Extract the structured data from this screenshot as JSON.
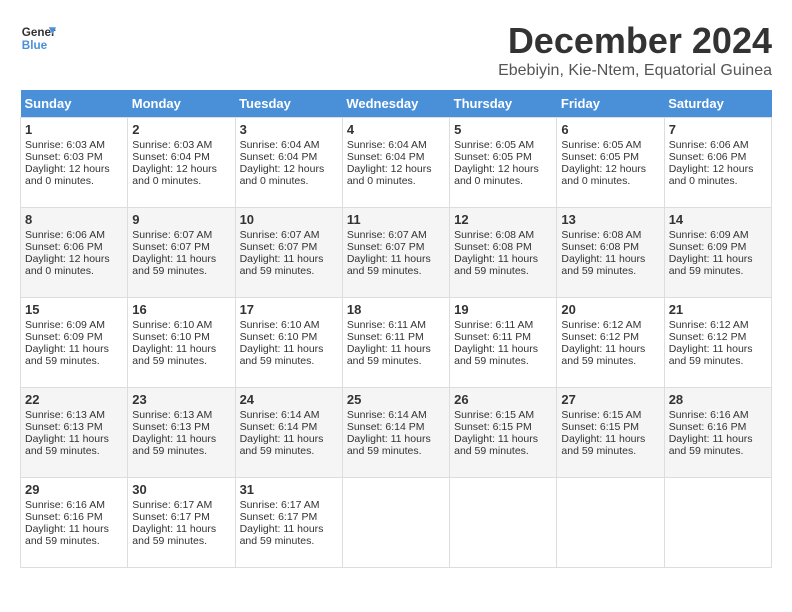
{
  "logo": {
    "line1": "General",
    "line2": "Blue"
  },
  "title": "December 2024",
  "subtitle": "Ebebiyin, Kie-Ntem, Equatorial Guinea",
  "weekdays": [
    "Sunday",
    "Monday",
    "Tuesday",
    "Wednesday",
    "Thursday",
    "Friday",
    "Saturday"
  ],
  "weeks": [
    [
      {
        "day": "1",
        "sunrise": "6:03 AM",
        "sunset": "6:03 PM",
        "daylight": "12 hours and 0 minutes."
      },
      {
        "day": "2",
        "sunrise": "6:03 AM",
        "sunset": "6:04 PM",
        "daylight": "12 hours and 0 minutes."
      },
      {
        "day": "3",
        "sunrise": "6:04 AM",
        "sunset": "6:04 PM",
        "daylight": "12 hours and 0 minutes."
      },
      {
        "day": "4",
        "sunrise": "6:04 AM",
        "sunset": "6:04 PM",
        "daylight": "12 hours and 0 minutes."
      },
      {
        "day": "5",
        "sunrise": "6:05 AM",
        "sunset": "6:05 PM",
        "daylight": "12 hours and 0 minutes."
      },
      {
        "day": "6",
        "sunrise": "6:05 AM",
        "sunset": "6:05 PM",
        "daylight": "12 hours and 0 minutes."
      },
      {
        "day": "7",
        "sunrise": "6:06 AM",
        "sunset": "6:06 PM",
        "daylight": "12 hours and 0 minutes."
      }
    ],
    [
      {
        "day": "8",
        "sunrise": "6:06 AM",
        "sunset": "6:06 PM",
        "daylight": "12 hours and 0 minutes."
      },
      {
        "day": "9",
        "sunrise": "6:07 AM",
        "sunset": "6:07 PM",
        "daylight": "11 hours and 59 minutes."
      },
      {
        "day": "10",
        "sunrise": "6:07 AM",
        "sunset": "6:07 PM",
        "daylight": "11 hours and 59 minutes."
      },
      {
        "day": "11",
        "sunrise": "6:07 AM",
        "sunset": "6:07 PM",
        "daylight": "11 hours and 59 minutes."
      },
      {
        "day": "12",
        "sunrise": "6:08 AM",
        "sunset": "6:08 PM",
        "daylight": "11 hours and 59 minutes."
      },
      {
        "day": "13",
        "sunrise": "6:08 AM",
        "sunset": "6:08 PM",
        "daylight": "11 hours and 59 minutes."
      },
      {
        "day": "14",
        "sunrise": "6:09 AM",
        "sunset": "6:09 PM",
        "daylight": "11 hours and 59 minutes."
      }
    ],
    [
      {
        "day": "15",
        "sunrise": "6:09 AM",
        "sunset": "6:09 PM",
        "daylight": "11 hours and 59 minutes."
      },
      {
        "day": "16",
        "sunrise": "6:10 AM",
        "sunset": "6:10 PM",
        "daylight": "11 hours and 59 minutes."
      },
      {
        "day": "17",
        "sunrise": "6:10 AM",
        "sunset": "6:10 PM",
        "daylight": "11 hours and 59 minutes."
      },
      {
        "day": "18",
        "sunrise": "6:11 AM",
        "sunset": "6:11 PM",
        "daylight": "11 hours and 59 minutes."
      },
      {
        "day": "19",
        "sunrise": "6:11 AM",
        "sunset": "6:11 PM",
        "daylight": "11 hours and 59 minutes."
      },
      {
        "day": "20",
        "sunrise": "6:12 AM",
        "sunset": "6:12 PM",
        "daylight": "11 hours and 59 minutes."
      },
      {
        "day": "21",
        "sunrise": "6:12 AM",
        "sunset": "6:12 PM",
        "daylight": "11 hours and 59 minutes."
      }
    ],
    [
      {
        "day": "22",
        "sunrise": "6:13 AM",
        "sunset": "6:13 PM",
        "daylight": "11 hours and 59 minutes."
      },
      {
        "day": "23",
        "sunrise": "6:13 AM",
        "sunset": "6:13 PM",
        "daylight": "11 hours and 59 minutes."
      },
      {
        "day": "24",
        "sunrise": "6:14 AM",
        "sunset": "6:14 PM",
        "daylight": "11 hours and 59 minutes."
      },
      {
        "day": "25",
        "sunrise": "6:14 AM",
        "sunset": "6:14 PM",
        "daylight": "11 hours and 59 minutes."
      },
      {
        "day": "26",
        "sunrise": "6:15 AM",
        "sunset": "6:15 PM",
        "daylight": "11 hours and 59 minutes."
      },
      {
        "day": "27",
        "sunrise": "6:15 AM",
        "sunset": "6:15 PM",
        "daylight": "11 hours and 59 minutes."
      },
      {
        "day": "28",
        "sunrise": "6:16 AM",
        "sunset": "6:16 PM",
        "daylight": "11 hours and 59 minutes."
      }
    ],
    [
      {
        "day": "29",
        "sunrise": "6:16 AM",
        "sunset": "6:16 PM",
        "daylight": "11 hours and 59 minutes."
      },
      {
        "day": "30",
        "sunrise": "6:17 AM",
        "sunset": "6:17 PM",
        "daylight": "11 hours and 59 minutes."
      },
      {
        "day": "31",
        "sunrise": "6:17 AM",
        "sunset": "6:17 PM",
        "daylight": "11 hours and 59 minutes."
      },
      null,
      null,
      null,
      null
    ]
  ],
  "labels": {
    "sunrise": "Sunrise:",
    "sunset": "Sunset:",
    "daylight": "Daylight:"
  }
}
